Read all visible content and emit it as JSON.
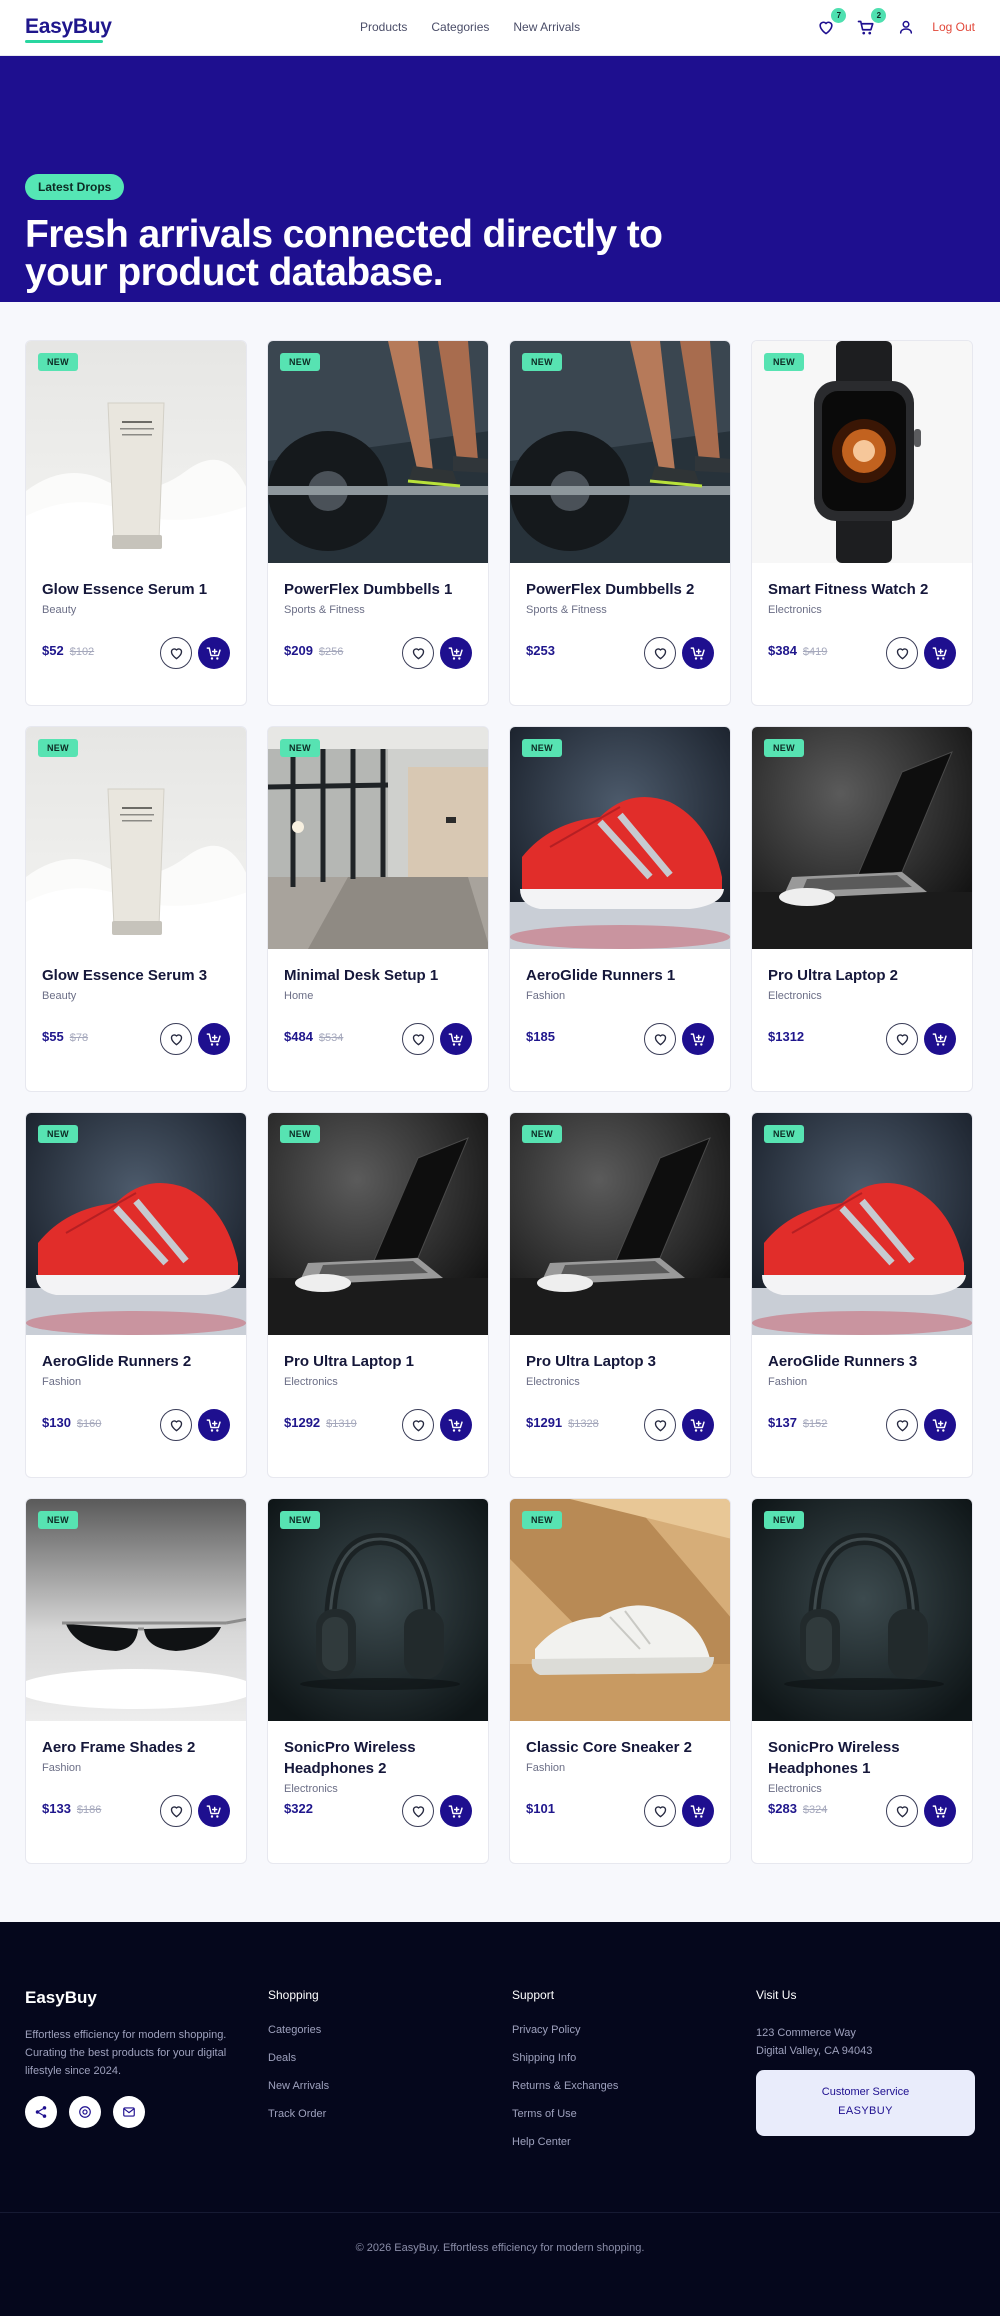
{
  "header": {
    "logo": "EasyBuy",
    "nav": [
      "Products",
      "Categories",
      "New Arrivals"
    ],
    "wishlist_count": "7",
    "cart_count": "2",
    "logout_label": "Log Out"
  },
  "hero": {
    "badge": "Latest Drops",
    "title": "Fresh arrivals connected directly to your product database."
  },
  "product_badge": "NEW",
  "products": [
    {
      "name": "Glow Essence Serum 1",
      "category": "Beauty",
      "price": "$52",
      "old_price": "$102",
      "image": "serum"
    },
    {
      "name": "PowerFlex Dumbbells 1",
      "category": "Sports & Fitness",
      "price": "$209",
      "old_price": "$256",
      "image": "gym"
    },
    {
      "name": "PowerFlex Dumbbells 2",
      "category": "Sports & Fitness",
      "price": "$253",
      "old_price": "",
      "image": "gym"
    },
    {
      "name": "Smart Fitness Watch 2",
      "category": "Electronics",
      "price": "$384",
      "old_price": "$419",
      "image": "watch"
    },
    {
      "name": "Glow Essence Serum 3",
      "category": "Beauty",
      "price": "$55",
      "old_price": "$78",
      "image": "serum"
    },
    {
      "name": "Minimal Desk Setup 1",
      "category": "Home",
      "price": "$484",
      "old_price": "$534",
      "image": "office"
    },
    {
      "name": "AeroGlide Runners 1",
      "category": "Fashion",
      "price": "$185",
      "old_price": "",
      "image": "sneaker"
    },
    {
      "name": "Pro Ultra Laptop 2",
      "category": "Electronics",
      "price": "$1312",
      "old_price": "",
      "image": "laptop"
    },
    {
      "name": "AeroGlide Runners 2",
      "category": "Fashion",
      "price": "$130",
      "old_price": "$160",
      "image": "sneaker"
    },
    {
      "name": "Pro Ultra Laptop 1",
      "category": "Electronics",
      "price": "$1292",
      "old_price": "$1319",
      "image": "laptop"
    },
    {
      "name": "Pro Ultra Laptop 3",
      "category": "Electronics",
      "price": "$1291",
      "old_price": "$1328",
      "image": "laptop"
    },
    {
      "name": "AeroGlide Runners 3",
      "category": "Fashion",
      "price": "$137",
      "old_price": "$152",
      "image": "sneaker"
    },
    {
      "name": "Aero Frame Shades 2",
      "category": "Fashion",
      "price": "$133",
      "old_price": "$186",
      "image": "shades"
    },
    {
      "name": "SonicPro Wireless Headphones 2",
      "category": "Electronics",
      "price": "$322",
      "old_price": "",
      "image": "headphones"
    },
    {
      "name": "Classic Core Sneaker 2",
      "category": "Fashion",
      "price": "$101",
      "old_price": "",
      "image": "whitesneaker"
    },
    {
      "name": "SonicPro Wireless Headphones 1",
      "category": "Electronics",
      "price": "$283",
      "old_price": "$324",
      "image": "headphones"
    }
  ],
  "footer": {
    "logo": "EasyBuy",
    "description": "Effortless efficiency for modern shopping. Curating the best products for your digital lifestyle since 2024.",
    "shopping": {
      "title": "Shopping",
      "links": [
        "Categories",
        "Deals",
        "New Arrivals",
        "Track Order"
      ]
    },
    "support": {
      "title": "Support",
      "links": [
        "Privacy Policy",
        "Shipping Info",
        "Returns & Exchanges",
        "Terms of Use",
        "Help Center"
      ]
    },
    "visit": {
      "title": "Visit Us",
      "address_line1": "123 Commerce Way",
      "address_line2": "Digital Valley, CA 94043"
    },
    "service": {
      "line1": "Customer Service",
      "line2": "EASYBUY"
    },
    "copyright": "© 2026 EasyBuy. Effortless efficiency for modern shopping."
  },
  "colors": {
    "brand": "#1e0f8f",
    "accent": "#55e6b5",
    "logout": "#e2483a",
    "footer_bg": "#05071c"
  }
}
